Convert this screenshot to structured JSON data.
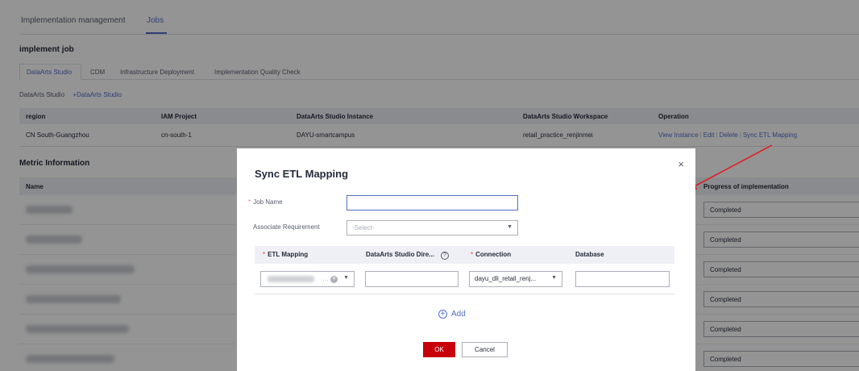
{
  "top_tabs": [
    {
      "label": "Implementation management",
      "active": false
    },
    {
      "label": "Jobs",
      "active": true
    }
  ],
  "implement_job": {
    "title": "implement job",
    "sub_tabs": [
      "DataArts Studio",
      "CDM",
      "Infrastructure Deployment",
      "Implementation Quality Check"
    ],
    "crumb": "DataArts Studio",
    "crumb_add": "+DataArts Studio",
    "columns": [
      "region",
      "IAM Project",
      "DataArts Studio Instance",
      "DataArts Studio Workspace",
      "Operation"
    ],
    "row": {
      "region": "CN South-Guangzhou",
      "iam_project": "cn-south-1",
      "instance": "DAYU-smartcampus",
      "workspace": "retail_practice_renjinmei",
      "operations": [
        "View Instance",
        "Edit",
        "Delete",
        "Sync ETL Mapping"
      ]
    }
  },
  "metric": {
    "title": "Metric Information",
    "col_name": "Name",
    "col_progress": "Progress of implementation",
    "statuses": [
      "Completed",
      "Completed",
      "Completed",
      "Completed",
      "Completed",
      "Completed"
    ]
  },
  "dialog": {
    "title": "Sync ETL Mapping",
    "close": "×",
    "job_name_label": "Job Name",
    "job_name_value": "",
    "assoc_label": "Associate Requirement",
    "assoc_placeholder": "-Select-",
    "grid_cols": [
      "ETL Mapping",
      "DataArts Studio Dire...",
      "Connection",
      "Database"
    ],
    "connection_value": "dayu_dli_retail_renj...",
    "add_label": "Add",
    "ok_label": "OK",
    "cancel_label": "Cancel",
    "required_mark": "*",
    "help_icon": "?",
    "add_icon": "+"
  },
  "colors": {
    "accent": "#526ecc",
    "ok": "#c7000b",
    "arrow": "#e8141b"
  }
}
